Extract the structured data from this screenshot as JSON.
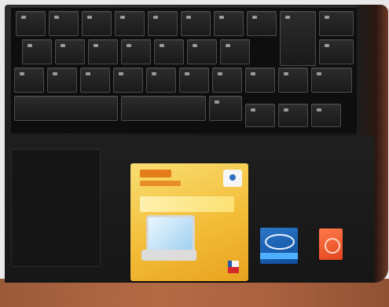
{
  "scene": {
    "subject": "laptop-palmrest",
    "stickers": [
      {
        "kind": "retail-program-sticker",
        "color": "#f3bd38"
      },
      {
        "kind": "processor-badge",
        "color": "#1a5fb4"
      },
      {
        "kind": "os-badge",
        "color": "#e8542a"
      }
    ],
    "colors": {
      "chassis": "#1b1b1b",
      "keys": "#222222",
      "table": "#a9613f",
      "background": "#e9e9e9"
    }
  }
}
